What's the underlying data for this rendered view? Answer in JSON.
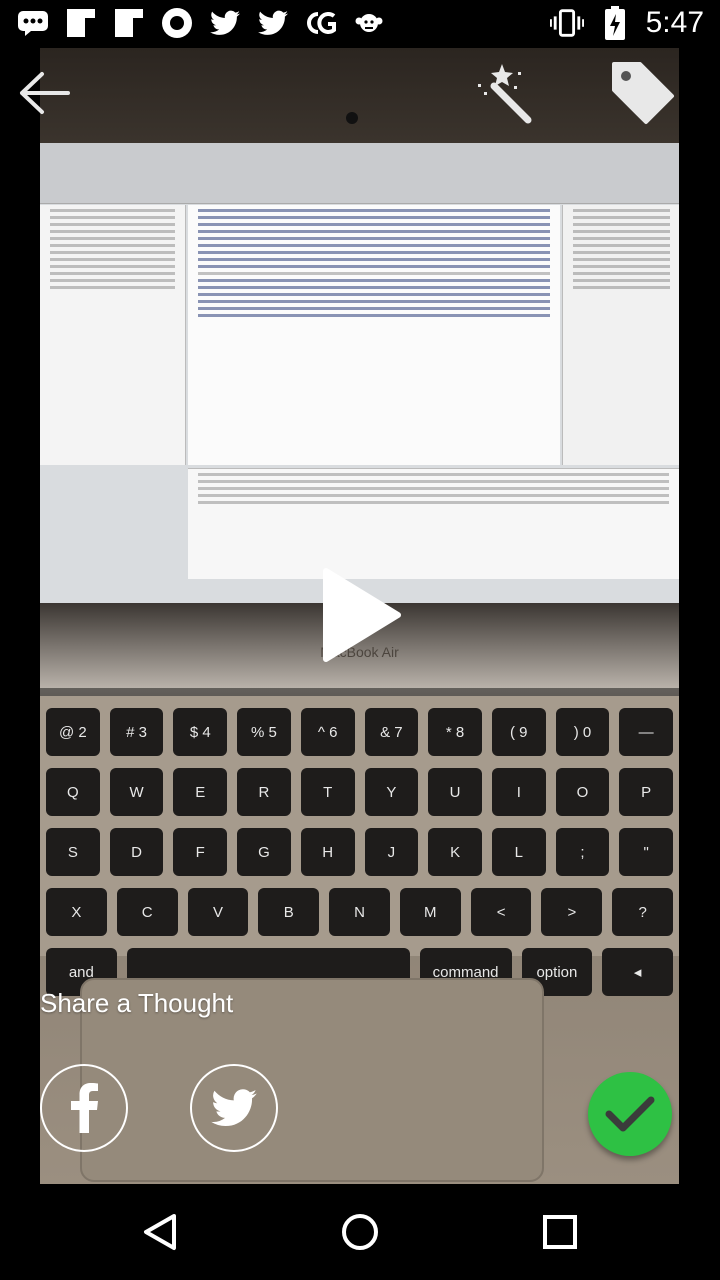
{
  "status_bar": {
    "time": "5:47",
    "notification_icons": [
      "chat-icon",
      "flipboard-icon",
      "flipboard-icon",
      "circle-app-icon",
      "twitter-icon",
      "twitter-icon",
      "cg-icon",
      "monkey-icon"
    ],
    "system_icons": [
      "vibrate-icon",
      "battery-charging-icon"
    ]
  },
  "toolbar": {
    "back": "back-arrow-icon",
    "magic": "magic-wand-icon",
    "tag": "tag-icon"
  },
  "media": {
    "play": "play-icon",
    "brand_text": "MacBook Air",
    "keyboard_rows": [
      [
        "@ 2",
        "# 3",
        "$ 4",
        "% 5",
        "^ 6",
        "& 7",
        "* 8",
        "( 9",
        ") 0",
        "—"
      ],
      [
        "Q",
        "W",
        "E",
        "R",
        "T",
        "Y",
        "U",
        "I",
        "O",
        "P"
      ],
      [
        "S",
        "D",
        "F",
        "G",
        "H",
        "J",
        "K",
        "L",
        ";",
        "\""
      ],
      [
        "X",
        "C",
        "V",
        "B",
        "N",
        "M",
        "<",
        ">",
        "?"
      ],
      [
        "and",
        "",
        "command",
        "option",
        "◂"
      ]
    ]
  },
  "share": {
    "label": "Share a Thought",
    "facebook": "facebook-icon",
    "twitter": "twitter-icon",
    "confirm": "checkmark-icon"
  },
  "navbar": {
    "back": "nav-back-icon",
    "home": "nav-home-icon",
    "recents": "nav-recents-icon"
  },
  "colors": {
    "confirm_green": "#2ec144",
    "overlay_white": "#ffffff"
  }
}
